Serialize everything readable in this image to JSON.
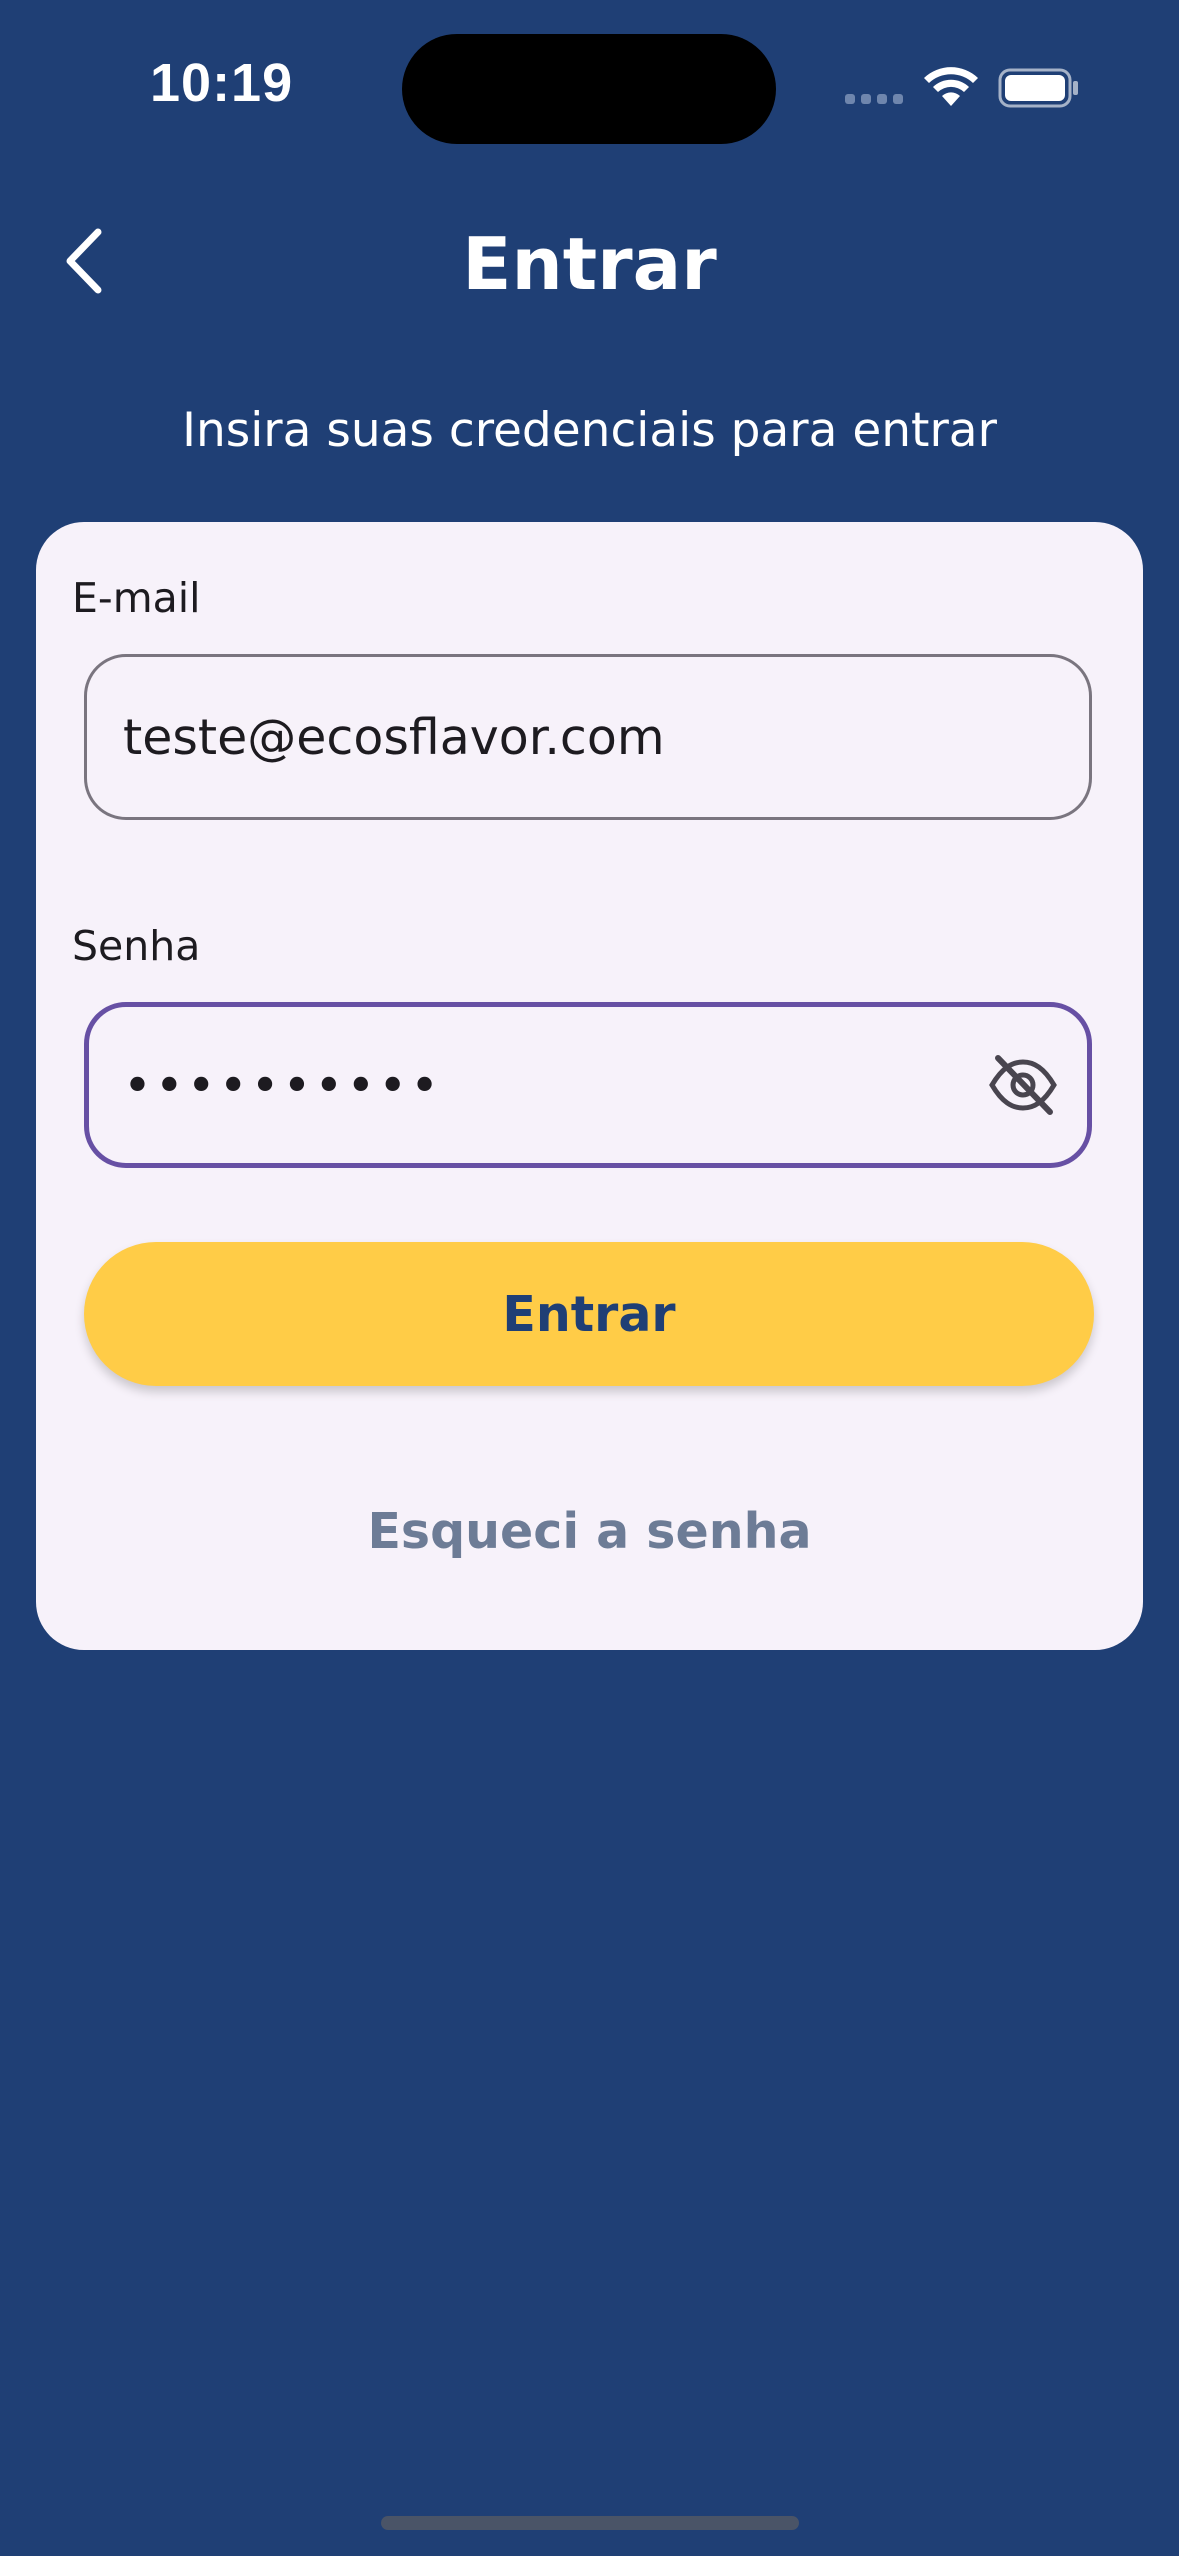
{
  "status_bar": {
    "time": "10:19"
  },
  "header": {
    "title": "Entrar",
    "back_icon": "chevron-left-icon"
  },
  "subtitle": "Insira suas credenciais para entrar",
  "form": {
    "email": {
      "label": "E-mail",
      "value": "teste@ecosflavor.com"
    },
    "password": {
      "label": "Senha",
      "value": "••••••••••",
      "visibility_icon": "eye-off-icon"
    },
    "submit_label": "Entrar",
    "forgot_password_label": "Esqueci a senha"
  },
  "colors": {
    "background": "#1f3f75",
    "card": "#f7f2fa",
    "primary_button": "#ffcc47",
    "focus_border": "#6750a4",
    "link": "#6d7c96"
  }
}
